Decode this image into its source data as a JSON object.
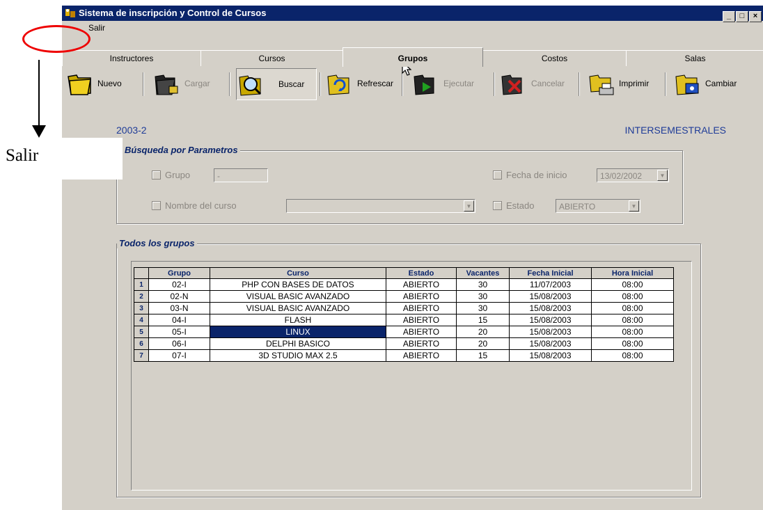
{
  "window": {
    "title": "Sistema de inscripción y Control de Cursos",
    "controls": [
      "_",
      "□",
      "×"
    ]
  },
  "menu": {
    "items": [
      "Salir"
    ]
  },
  "tabs": [
    {
      "label": "Instructores",
      "active": false
    },
    {
      "label": "Cursos",
      "active": false
    },
    {
      "label": "Grupos",
      "active": true
    },
    {
      "label": "Costos",
      "active": false
    },
    {
      "label": "Salas",
      "active": false
    }
  ],
  "toolbar": {
    "nuevo": "Nuevo",
    "cargar": "Cargar",
    "buscar": "Buscar",
    "refrescar": "Refrescar",
    "ejecutar": "Ejecutar",
    "cancelar": "Cancelar",
    "imprimir": "Imprimir",
    "cambiar": "Cambiar"
  },
  "header": {
    "period": "2003-2",
    "type": "INTERSEMESTRALES"
  },
  "search": {
    "legend": "Búsqueda por Parametros",
    "grupo_label": "Grupo",
    "grupo_value": "-",
    "fecha_label": "Fecha de inicio",
    "fecha_value": "13/02/2002",
    "nombre_label": "Nombre del curso",
    "nombre_value": "",
    "estado_label": "Estado",
    "estado_value": "ABIERTO"
  },
  "groups": {
    "legend": "Todos los grupos",
    "columns": [
      "Grupo",
      "Curso",
      "Estado",
      "Vacantes",
      "Fecha Inicial",
      "Hora Inicial"
    ],
    "rows": [
      {
        "n": "1",
        "grupo": "02-I",
        "curso": "PHP CON BASES DE DATOS",
        "estado": "ABIERTO",
        "vacantes": "30",
        "fecha": "11/07/2003",
        "hora": "08:00"
      },
      {
        "n": "2",
        "grupo": "02-N",
        "curso": "VISUAL BASIC AVANZADO",
        "estado": "ABIERTO",
        "vacantes": "30",
        "fecha": "15/08/2003",
        "hora": "08:00"
      },
      {
        "n": "3",
        "grupo": "03-N",
        "curso": "VISUAL BASIC AVANZADO",
        "estado": "ABIERTO",
        "vacantes": "30",
        "fecha": "15/08/2003",
        "hora": "08:00"
      },
      {
        "n": "4",
        "grupo": "04-I",
        "curso": "FLASH",
        "estado": "ABIERTO",
        "vacantes": "15",
        "fecha": "15/08/2003",
        "hora": "08:00"
      },
      {
        "n": "5",
        "grupo": "05-I",
        "curso": "LINUX",
        "estado": "ABIERTO",
        "vacantes": "20",
        "fecha": "15/08/2003",
        "hora": "08:00"
      },
      {
        "n": "6",
        "grupo": "06-I",
        "curso": "DELPHI BASICO",
        "estado": "ABIERTO",
        "vacantes": "20",
        "fecha": "15/08/2003",
        "hora": "08:00"
      },
      {
        "n": "7",
        "grupo": "07-I",
        "curso": "3D STUDIO MAX 2.5",
        "estado": "ABIERTO",
        "vacantes": "15",
        "fecha": "15/08/2003",
        "hora": "08:00"
      }
    ],
    "selected_row": 5
  },
  "annotation": {
    "label": "Salir"
  },
  "colors": {
    "title_bar": "#0a246a",
    "face": "#d4d0c8",
    "accent_text": "#1f3c98",
    "annotation": "#ee0000"
  }
}
